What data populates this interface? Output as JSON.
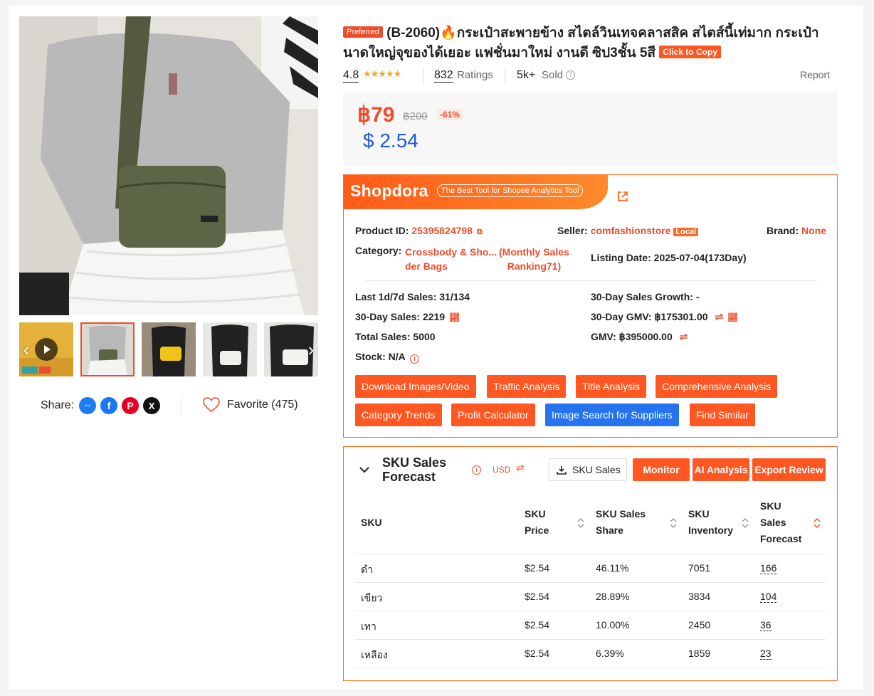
{
  "product": {
    "preferred_badge": "Preferred",
    "title": "(B-2060)🔥กระเป๋าสะพายข้าง สไตล์วินเทจคลาสสิค สไตส์นี้เท่มาก กระเป๋านาดใหญ่จุของได้เยอะ แฟชั่นมาใหม่ งานดี ซิป3ชั้น 5สี",
    "copy_label": "Click to Copy",
    "rating": "4.8",
    "ratings_count": "832",
    "ratings_label": "Ratings",
    "sold_count": "5k+",
    "sold_label": "Sold",
    "report_label": "Report",
    "price": "฿79",
    "original_price": "฿200",
    "discount": "-61%",
    "usd_price": "$ 2.54",
    "star_count": 5
  },
  "share": {
    "label": "Share:",
    "icons": [
      "messenger-icon",
      "facebook-icon",
      "pinterest-icon",
      "x-icon"
    ],
    "favorite_label": "Favorite (475)"
  },
  "shopdora": {
    "logo": "Shopdora",
    "tagline": "The Best Tool for Shopee Analytics Tool",
    "product_id_label": "Product ID:",
    "product_id": "25395824798",
    "seller_label": "Seller:",
    "seller": "comfashionstore",
    "seller_badge": "Local",
    "brand_label": "Brand:",
    "brand": "None",
    "category_label": "Category:",
    "category_line1": "Crossbody & Sho...",
    "category_line2": "der Bags",
    "ranking_line1": "(Monthly Sales",
    "ranking_line2": "Ranking71)",
    "listing_date": "Listing Date: 2025-07-04(173Day)",
    "sales_1d7d": "Last 1d/7d Sales: 31/134",
    "sales_growth": "30-Day Sales Growth: -",
    "sales_30d": "30-Day Sales: 2219",
    "gmv_30d": "30-Day GMV: ฿175301.00",
    "total_sales": "Total Sales: 5000",
    "gmv": "GMV: ฿395000.00",
    "stock": "Stock: N/A",
    "buttons": {
      "download": "Download Images/Video",
      "traffic": "Traffic Analysis",
      "title_analysis": "Title Analysis",
      "comprehensive": "Comprehensive Analysis",
      "category_trends": "Category Trends",
      "profit": "Profit Calculator",
      "image_search": "Image Search for Suppliers",
      "find_similar": "Find Similar"
    }
  },
  "sku_panel": {
    "title_line1": "SKU Sales",
    "title_line2": "Forecast",
    "currency": "USD",
    "sku_sales_btn": "SKU Sales",
    "monitor_btn": "Monitor",
    "ai_btn": "AI Analysis",
    "export_btn": "Export Review",
    "headers": {
      "sku": "SKU",
      "price_1": "SKU",
      "price_2": "Price",
      "share_1": "SKU Sales",
      "share_2": "Share",
      "inv_1": "SKU",
      "inv_2": "Inventory",
      "fc_1": "SKU",
      "fc_2": "Sales",
      "fc_3": "Forecast"
    },
    "rows": [
      {
        "sku": "ดำ",
        "price": "$2.54",
        "share": "46.11%",
        "inventory": "7051",
        "forecast": "166"
      },
      {
        "sku": "เขียว",
        "price": "$2.54",
        "share": "28.89%",
        "inventory": "3834",
        "forecast": "104"
      },
      {
        "sku": "เทา",
        "price": "$2.54",
        "share": "10.00%",
        "inventory": "2450",
        "forecast": "36"
      },
      {
        "sku": "เหลือง",
        "price": "$2.54",
        "share": "6.39%",
        "inventory": "1859",
        "forecast": "23"
      }
    ]
  },
  "colors": {
    "accent": "#ee4d2d",
    "shopdora_orange": "#ff5722",
    "blue": "#2673f0",
    "usd_blue": "#2059d9"
  }
}
